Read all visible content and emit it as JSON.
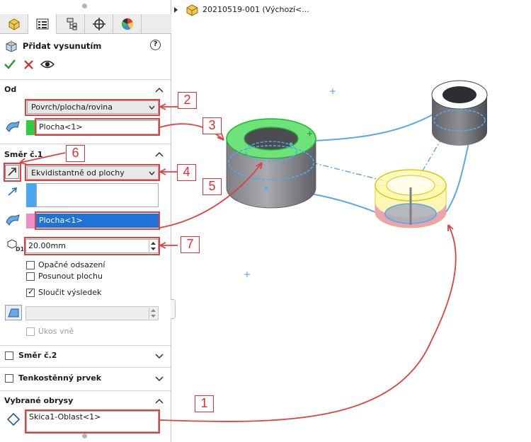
{
  "tree": {
    "item_label": "20210519-001  (Výchozí<..."
  },
  "feature": {
    "title": "Přidat vysunutím",
    "help_glyph": "?"
  },
  "sections": {
    "od": {
      "heading": "Od",
      "start_condition": "Povrch/plocha/rovina",
      "face_selection": "Plocha<1>"
    },
    "smer1": {
      "heading": "Směr č.1",
      "end_condition": "Ekvidistantně od plochy",
      "direction_selection": "",
      "face_selection": "Plocha<1>",
      "offset_value": "20.00mm",
      "reverse_offset": "Opačné odsazení",
      "translate_surface": "Posunout plochu",
      "merge_result": "Sloučit výsledek",
      "merge_checked": true,
      "draft_outward": "Úkos vně"
    },
    "smer2": {
      "heading": "Směr č.2"
    },
    "thin": {
      "heading": "Tenkostěnný prvek"
    },
    "contours": {
      "heading": "Vybrané obrysy",
      "selection": "Skica1-Oblast<1>"
    }
  },
  "callouts": [
    "1",
    "2",
    "3",
    "4",
    "5",
    "6",
    "7"
  ],
  "colors": {
    "accent_red": "#e04040",
    "highlight_green": "#2ecc40",
    "selection_blue": "#1f73d6",
    "pink": "#f08cc8",
    "light_blue": "#4da6f0",
    "edge_blue": "#59a8e8"
  },
  "icons": [
    "feature-manager-icon",
    "property-manager-icon",
    "configuration-manager-icon",
    "dimxpert-icon",
    "display-manager-icon",
    "extrude-boss-icon",
    "ok-check-icon",
    "cancel-x-icon",
    "preview-eye-icon",
    "face-select-icon",
    "reverse-direction-icon",
    "direction-vector-icon",
    "offset-distance-icon",
    "draft-icon",
    "contour-icon",
    "part-icon"
  ]
}
